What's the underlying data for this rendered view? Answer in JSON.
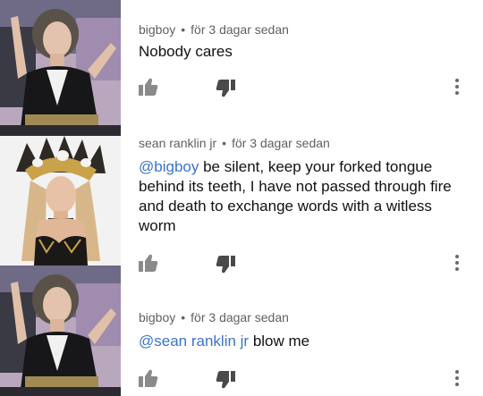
{
  "comments": [
    {
      "author": "bigboy",
      "time": "för 3 dagar sedan",
      "mention": "",
      "text": "Nobody cares",
      "photo_icon": "woman-portrait-image"
    },
    {
      "author": "sean ranklin jr",
      "time": "för 3 dagar sedan",
      "mention": "@bigboy",
      "text": " be silent, keep your forked tongue behind its teeth, I have not passed through fire and death to exchange words with a witless worm",
      "photo_icon": "woman-headdress-portrait-image"
    },
    {
      "author": "bigboy",
      "time": "för 3 dagar sedan",
      "mention": "@sean ranklin jr",
      "text": " blow me",
      "photo_icon": "woman-portrait-image"
    }
  ],
  "icons": {
    "like": "thumbs-up-icon",
    "dislike": "thumbs-down-icon",
    "more": "more-vert-icon"
  },
  "colors": {
    "mention": "#3a74c5",
    "meta": "#606060",
    "text": "#111111",
    "icon": "#8a8a8a"
  },
  "separator": "•"
}
